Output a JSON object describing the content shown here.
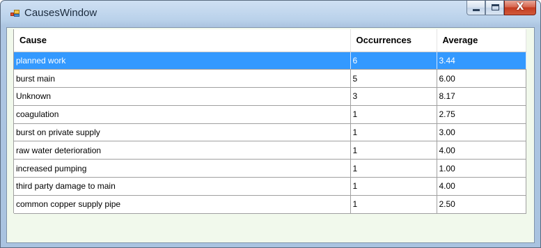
{
  "window": {
    "title": "CausesWindow",
    "close_glyph": "X"
  },
  "grid": {
    "columns": [
      "Cause",
      "Occurrences",
      "Average"
    ],
    "rows": [
      {
        "cause": "planned work",
        "occurrences": "6",
        "average": "3.44",
        "selected": true
      },
      {
        "cause": "burst main",
        "occurrences": "5",
        "average": "6.00",
        "selected": false
      },
      {
        "cause": "Unknown",
        "occurrences": "3",
        "average": "8.17",
        "selected": false
      },
      {
        "cause": "coagulation",
        "occurrences": "1",
        "average": "2.75",
        "selected": false
      },
      {
        "cause": "burst on private supply",
        "occurrences": "1",
        "average": "3.00",
        "selected": false
      },
      {
        "cause": "raw water deterioration",
        "occurrences": "1",
        "average": "4.00",
        "selected": false
      },
      {
        "cause": "increased pumping",
        "occurrences": "1",
        "average": "1.00",
        "selected": false
      },
      {
        "cause": "third party damage to main",
        "occurrences": "1",
        "average": "4.00",
        "selected": false
      },
      {
        "cause": "common copper supply pipe",
        "occurrences": "1",
        "average": "2.50",
        "selected": false
      }
    ]
  },
  "colors": {
    "selection": "#3399ff",
    "client_background": "#f1f9ec",
    "close_button": "#c43c20"
  }
}
